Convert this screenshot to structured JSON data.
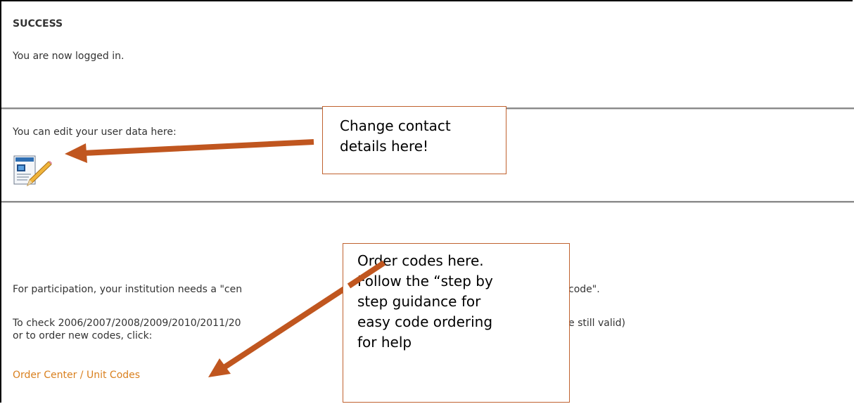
{
  "status": {
    "heading": "SUCCESS",
    "message": "You are now logged in."
  },
  "user_data": {
    "prompt": "You can edit your user data here:",
    "edit_icon": "edit-document-icon"
  },
  "codes": {
    "participation_start": "For participation, your institution needs a \"cen",
    "participation_end": "code\".",
    "check_start": "To check 2006/2007/2008/2009/2010/2011/20",
    "check_end": "e still valid)",
    "check_line2": "or to order new codes, click:",
    "order_link": "Order Center / Unit Codes"
  },
  "annotations": {
    "contact": {
      "lines": [
        "Change contact",
        "details here!"
      ]
    },
    "order": {
      "lines": [
        "Order codes here.",
        "Follow the “step by",
        "step guidance for",
        "easy code ordering",
        "for help"
      ]
    }
  },
  "colors": {
    "link": "#d9801f",
    "arrow": "#c0561f",
    "callout_border": "#c0622f"
  }
}
